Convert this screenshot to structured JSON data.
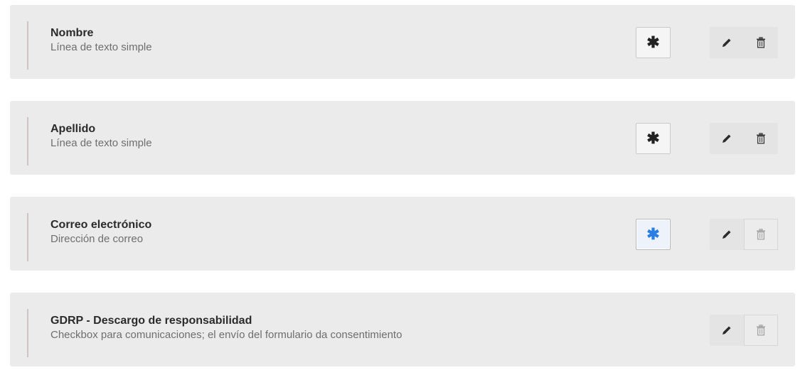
{
  "fields": [
    {
      "title": "Nombre",
      "subtitle": "Línea de texto simple",
      "required_symbol": "✱",
      "required_active": false,
      "delete_disabled": false,
      "show_required": true
    },
    {
      "title": "Apellido",
      "subtitle": "Línea de texto simple",
      "required_symbol": "✱",
      "required_active": false,
      "delete_disabled": false,
      "show_required": true
    },
    {
      "title": "Correo electrónico",
      "subtitle": "Dirección de correo",
      "required_symbol": "✱",
      "required_active": true,
      "delete_disabled": true,
      "show_required": true
    },
    {
      "title": "GDRP - Descargo de responsabilidad",
      "subtitle": "Checkbox para comunicaciones; el envío del formulario da consentimiento",
      "show_required": false,
      "delete_disabled": true
    }
  ],
  "icons": {
    "edit": "pencil-icon",
    "delete": "trash-icon",
    "required": "asterisk-icon"
  },
  "colors": {
    "row_background": "#ebebeb",
    "required_active": "#2a7ee3",
    "drag_bar": "#cfc4c4"
  }
}
